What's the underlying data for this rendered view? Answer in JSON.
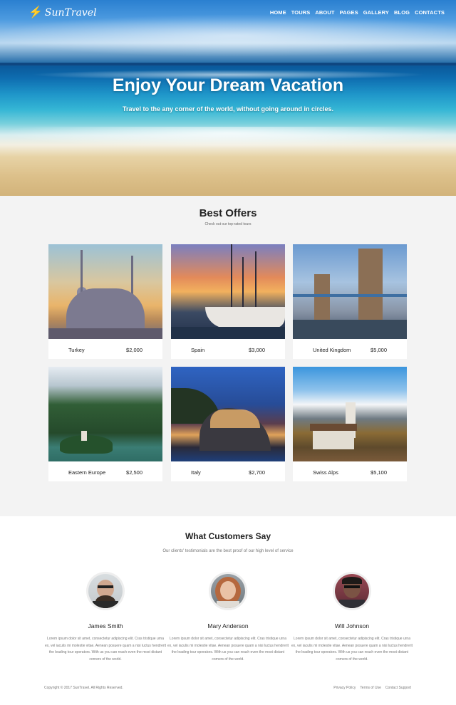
{
  "brand": {
    "name": "SunTravel",
    "icon": "bolt-icon",
    "icon_color": "#f5b21b"
  },
  "nav": [
    "HOME",
    "TOURS",
    "ABOUT",
    "PAGES",
    "GALLERY",
    "BLOG",
    "CONTACTS"
  ],
  "hero": {
    "title": "Enjoy Your Dream Vacation",
    "subtitle": "Travel to the any corner of the world, without going around in circles."
  },
  "offers": {
    "title": "Best Offers",
    "subtitle": "Check out our top-rated tours",
    "items": [
      {
        "name": "Turkey",
        "price": "$2,000",
        "image": "mosque-photo"
      },
      {
        "name": "Spain",
        "price": "$3,000",
        "image": "harbor-photo"
      },
      {
        "name": "United Kingdom",
        "price": "$5,000",
        "image": "tower-bridge-photo"
      },
      {
        "name": "Eastern Europe",
        "price": "$2,500",
        "image": "lake-island-photo"
      },
      {
        "name": "Italy",
        "price": "$2,700",
        "image": "coastal-town-photo"
      },
      {
        "name": "Swiss Alps",
        "price": "$5,100",
        "image": "alpine-church-photo"
      }
    ]
  },
  "testimonials": {
    "title": "What Customers Say",
    "subtitle": "Our clients' testimonials are the best proof of our high level of service",
    "people": [
      {
        "name": "James Smith",
        "text": "Lorem ipsum dolor sit amet, consectetur adipiscing elit. Cras tristique urna ex, vel iaculis mi molestie vitae. Aenean posuere quam a nisi luctus hendrerit the leading tour operators. With us you can reach even the most distant corners of the world."
      },
      {
        "name": "Mary Anderson",
        "text": "Lorem ipsum dolor sit amet, consectetur adipiscing elit. Cras tristique urna ex, vel iaculis mi molestie vitae. Aenean posuere quam a nisi luctus hendrerit the leading tour operators. With us you can reach even the most distant corners of the world."
      },
      {
        "name": "Will Johnson",
        "text": "Lorem ipsum dolor sit amet, consectetur adipiscing elit. Cras tristique urna ex, vel iaculis mi molestie vitae. Aenean posuere quam a nisi luctus hendrerit the leading tour operators. With us you can reach even the most distant corners of the world."
      }
    ]
  },
  "footer": {
    "copyright": "Copyright © 2017 SunTravel. All Rights Reserved.",
    "links": [
      "Privacy Policy",
      "Terms of Use",
      "Contact Support"
    ]
  }
}
